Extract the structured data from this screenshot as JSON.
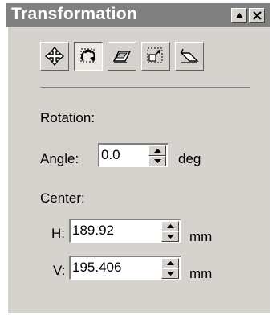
{
  "window": {
    "title": "Transformation",
    "titlebar_buttons": [
      {
        "name": "dock-toggle",
        "icon": "triangle-up-icon"
      },
      {
        "name": "close",
        "icon": "close-icon"
      }
    ]
  },
  "toolbar": {
    "tools": [
      {
        "name": "position",
        "icon": "move-arrows-icon",
        "active": false
      },
      {
        "name": "rotation",
        "icon": "rotate-icon",
        "active": true
      },
      {
        "name": "scale-mirror",
        "icon": "scale-mirror-icon",
        "active": false
      },
      {
        "name": "size",
        "icon": "size-icon",
        "active": false
      },
      {
        "name": "skew",
        "icon": "skew-icon",
        "active": false
      }
    ]
  },
  "rotation": {
    "section_label": "Rotation:",
    "angle_label": "Angle:",
    "angle_value": "0.0",
    "angle_unit": "deg",
    "center_label": "Center:",
    "h_label": "H:",
    "h_value": "189.92",
    "h_unit": "mm",
    "v_label": "V:",
    "v_value": "195.406",
    "v_unit": "mm"
  },
  "colors": {
    "titlebar": "#808080",
    "panel": "#d6d3ce"
  }
}
